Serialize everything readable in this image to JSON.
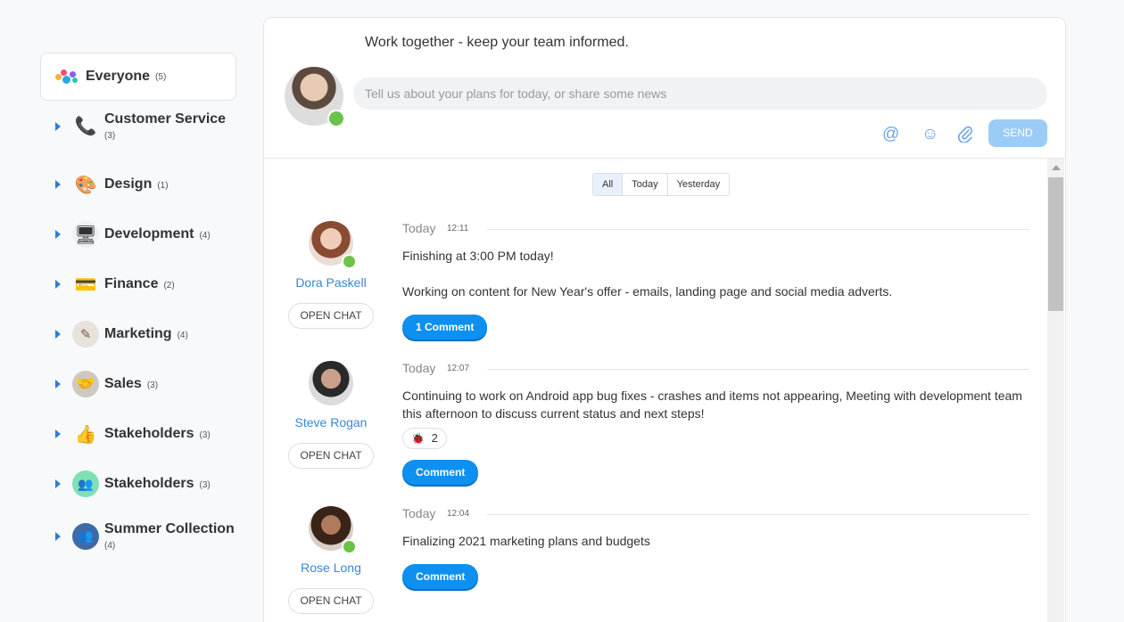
{
  "sidebar": {
    "everyone": {
      "label": "Everyone",
      "count": "(5)"
    },
    "groups": [
      {
        "label": "Customer Service",
        "count": "(3)",
        "icon": "phone-icon",
        "glyph": "📞"
      },
      {
        "label": "Design",
        "count": "(1)",
        "icon": "palette-icon",
        "glyph": "🎨"
      },
      {
        "label": "Development",
        "count": "(4)",
        "icon": "monitor-icon",
        "glyph": "🖥"
      },
      {
        "label": "Finance",
        "count": "(2)",
        "icon": "credit-card-icon",
        "glyph": "💳"
      },
      {
        "label": "Marketing",
        "count": "(4)",
        "icon": "marketing-image-icon",
        "glyph": "✎"
      },
      {
        "label": "Sales",
        "count": "(3)",
        "icon": "handshake-icon",
        "glyph": "🤝"
      },
      {
        "label": "Stakeholders",
        "count": "(3)",
        "icon": "thumbs-up-icon",
        "glyph": "👍"
      },
      {
        "label": "Stakeholders",
        "count": "(3)",
        "icon": "people-group-icon",
        "glyph": "👥"
      },
      {
        "label": "Summer Collection",
        "count": "(4)",
        "icon": "people-group-icon",
        "glyph": "👥"
      }
    ]
  },
  "composer": {
    "title": "Work together - keep your team informed.",
    "placeholder": "Tell us about your plans for today, or share some news",
    "send_label": "SEND"
  },
  "filters": [
    "All",
    "Today",
    "Yesterday"
  ],
  "posts": [
    {
      "name": "Dora Paskell",
      "open_chat": "OPEN CHAT",
      "day": "Today",
      "time": "12:11",
      "lines": [
        "Finishing at 3:00 PM today!",
        "Working on content for New Year's offer - emails, landing page and social media adverts."
      ],
      "comment_label": "1 Comment"
    },
    {
      "name": "Steve Rogan",
      "open_chat": "OPEN CHAT",
      "day": "Today",
      "time": "12:07",
      "lines": [
        "Continuing to work on Android app bug fixes - crashes and items not appearing, Meeting with development team this afternoon to discuss current status and next steps!"
      ],
      "reaction": {
        "icon": "bug-icon",
        "glyph": "🐞",
        "count": "2"
      },
      "comment_label": "Comment"
    },
    {
      "name": "Rose Long",
      "open_chat": "OPEN CHAT",
      "day": "Today",
      "time": "12:04",
      "lines": [
        "Finalizing 2021 marketing plans and budgets"
      ],
      "comment_label": "Comment"
    }
  ],
  "colors": {
    "accent": "#0e90f0",
    "online": "#6cc24a",
    "link": "#3a86d5"
  }
}
